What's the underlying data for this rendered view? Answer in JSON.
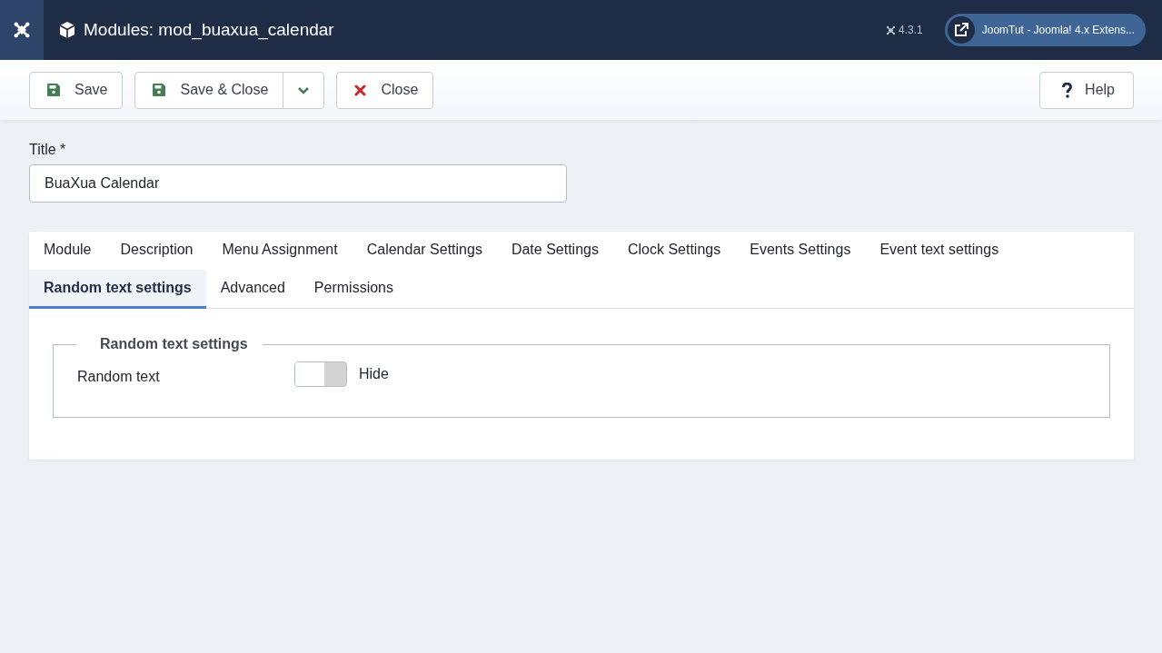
{
  "header": {
    "title": "Modules: mod_buaxua_calendar",
    "version": "4.3.1",
    "site_link": "JoomTut - Joomla! 4.x Extens..."
  },
  "toolbar": {
    "buttons": [
      {
        "kind": "save",
        "label": "Save"
      },
      {
        "kind": "save_split",
        "label": "Save & Close"
      },
      {
        "kind": "close",
        "label": "Close"
      }
    ],
    "help": {
      "label": "Help"
    }
  },
  "title_field": {
    "label": "Title *",
    "value": "BuaXua Calendar"
  },
  "tabs": [
    {
      "label": "Module",
      "selected": false
    },
    {
      "label": "Description",
      "selected": false
    },
    {
      "label": "Menu Assignment",
      "selected": false
    },
    {
      "label": "Calendar Settings",
      "selected": false
    },
    {
      "label": "Date Settings",
      "selected": false
    },
    {
      "label": "Clock Settings",
      "selected": false
    },
    {
      "label": "Events Settings",
      "selected": false
    },
    {
      "label": "Event text settings",
      "selected": false
    },
    {
      "label": "Random text settings",
      "selected": true
    },
    {
      "label": "Advanced",
      "selected": false
    },
    {
      "label": "Permissions",
      "selected": false
    }
  ],
  "fieldset": {
    "legend": "Random text settings",
    "fields": [
      {
        "label": "Random text",
        "on": false,
        "state_label": "Hide"
      }
    ]
  }
}
